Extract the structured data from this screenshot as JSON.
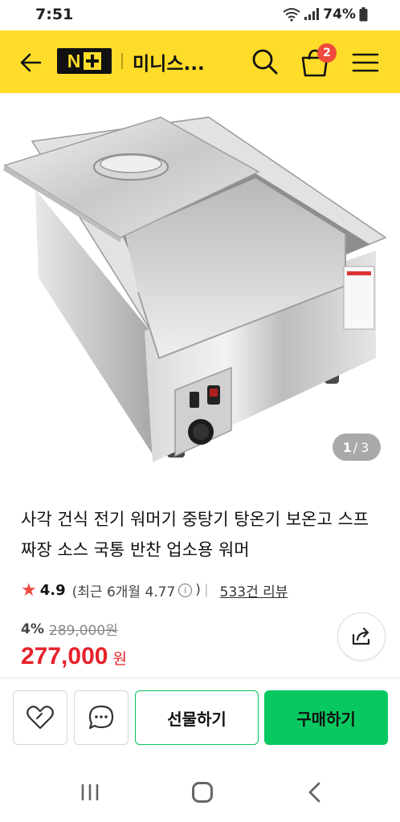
{
  "status_bar": {
    "time": "7:51",
    "battery": "74%"
  },
  "header": {
    "logo_text": "N",
    "title": "미니스...",
    "cart_count": "2"
  },
  "gallery": {
    "current": "1",
    "separator": "/",
    "total": "3"
  },
  "product": {
    "title": "사각 건식 전기 워머기 중탕기 탕온기 보온고 스프 짜장 소스 국통 반찬 업소용 워머",
    "rating": "4.9",
    "rating_recent": "(최근 6개월 4.77",
    "rating_close": ")",
    "review_link": "533건 리뷰",
    "discount_rate": "4%",
    "original_price": "289,000원",
    "price": "277,000",
    "price_unit": "원"
  },
  "actions": {
    "gift_label": "선물하기",
    "buy_label": "구매하기"
  },
  "colors": {
    "header_bg": "#ffdc2a",
    "price": "#e8212b",
    "buy_green": "#08c960",
    "badge": "#f04a3d"
  }
}
